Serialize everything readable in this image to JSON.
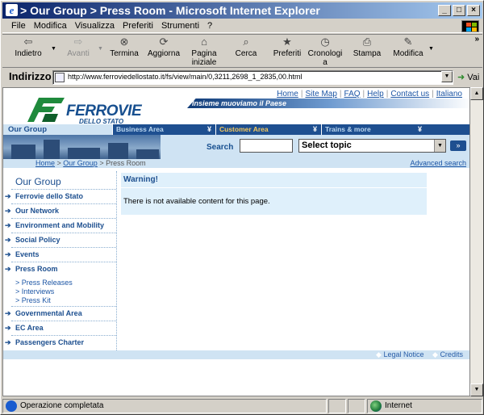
{
  "window": {
    "title": "> Our Group > Press Room - Microsoft Internet Explorer"
  },
  "menu": [
    "File",
    "Modifica",
    "Visualizza",
    "Preferiti",
    "Strumenti",
    "?"
  ],
  "toolbar": {
    "back": "Indietro",
    "forward": "Avanti",
    "stop": "Termina",
    "refresh": "Aggiorna",
    "home_line1": "Pagina",
    "home_line2": "iniziale",
    "search": "Cerca",
    "favorites": "Preferiti",
    "history_line1": "Cronologi",
    "history_line2": "a",
    "print": "Stampa",
    "edit": "Modifica",
    "chevron": "»"
  },
  "address": {
    "label": "Indirizzo",
    "url": "http://www.ferroviedellostato.it/fs/view/main/0,3211,2698_1_2835,00.html",
    "go": "Vai"
  },
  "site": {
    "toplinks": [
      "Home",
      "Site Map",
      "FAQ",
      "Help",
      "Contact us",
      "Italiano"
    ],
    "brand": "FERROVIE",
    "brand_sub": "DELLO STATO",
    "slogan": "Insieme muoviamo il Paese",
    "nav": {
      "current": "Our Group",
      "tabs": [
        "Business Area",
        "Customer Area",
        "Trains & more"
      ]
    },
    "search": {
      "label": "Search",
      "value": "",
      "topic": "Select topic",
      "go": "»"
    },
    "breadcrumb": {
      "home": "Home",
      "sep1": " > ",
      "our_group": "Our Group",
      "sep2": " > ",
      "current": "Press Room"
    },
    "advanced_search": "Advanced search",
    "sidebar": {
      "title": "Our Group",
      "items": [
        "Ferrovie dello Stato",
        "Our Network",
        "Environment and Mobility",
        "Social Policy",
        "Events",
        "Press Room"
      ],
      "subitems": [
        "> Press Releases",
        "> Interviews",
        "> Press Kit"
      ],
      "items2": [
        "Governmental Area",
        "EC Area",
        "Passengers Charter"
      ]
    },
    "warning": {
      "title": "Warning!",
      "message": "There is not available content for this page."
    },
    "footer": {
      "legal": "Legal Notice",
      "credits": "Credits"
    }
  },
  "status": {
    "text": "Operazione completata",
    "zone": "Internet"
  },
  "colors": {
    "title_start": "#0a246a",
    "title_end": "#a6caf0",
    "site_blue": "#1e4f90",
    "light_blue": "#cfe3f3",
    "customer_tab": "#f3c75e"
  }
}
